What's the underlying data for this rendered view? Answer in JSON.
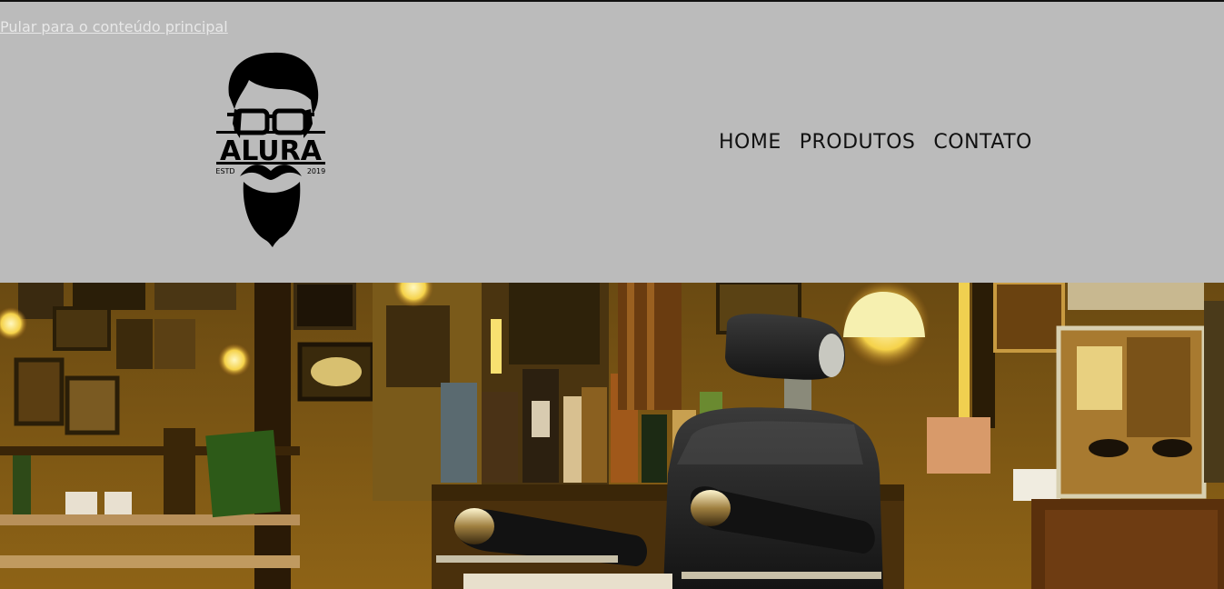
{
  "skip_link": "Pular para o conteúdo principal",
  "logo": {
    "brand": "ALURA",
    "estd": "ESTD",
    "year": "2019"
  },
  "nav": {
    "items": [
      "HOME",
      "PRODUTOS",
      "CONTATO"
    ]
  },
  "hero": {
    "image": "barbershop-interior-photo"
  },
  "colors": {
    "header_bg": "#bbbbbb",
    "text": "#111111",
    "skip_link": "#e8e8e8"
  }
}
